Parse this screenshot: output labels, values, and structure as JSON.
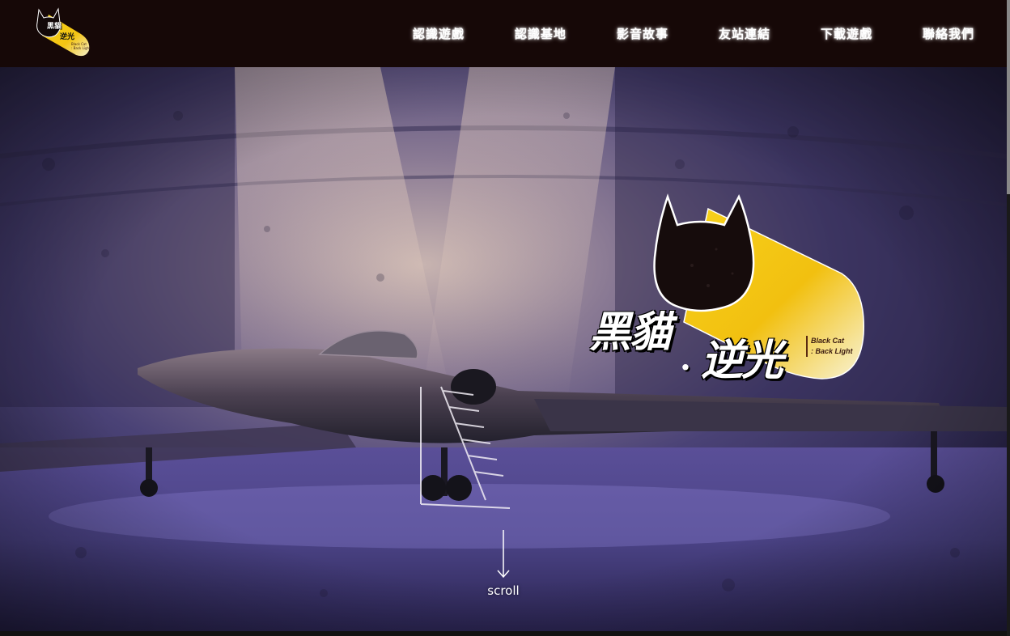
{
  "header": {
    "logo": {
      "title_zh": "黑貓",
      "title_zh2": "逆光",
      "sub_line1": "Black Cat",
      "sub_line2": ": Back Light"
    },
    "nav": [
      {
        "label": "認識遊戲"
      },
      {
        "label": "認識基地"
      },
      {
        "label": "影音故事"
      },
      {
        "label": "友站連結"
      },
      {
        "label": "下載遊戲"
      },
      {
        "label": "聯絡我們"
      }
    ]
  },
  "hero": {
    "title_part1": "黑貓",
    "separator": "·",
    "title_part2": "逆光",
    "subtitle_line1": "Black Cat",
    "subtitle_line2": ": Back Light",
    "scroll_label": "scroll"
  },
  "colors": {
    "header_bg": "#160807",
    "accent_yellow": "#f5c518",
    "hero_purple": "#3a3268"
  },
  "icons": {
    "header_logo": "black-cat-logo-icon",
    "hero_logo": "black-cat-emblem-icon",
    "scroll": "arrow-down-icon"
  }
}
